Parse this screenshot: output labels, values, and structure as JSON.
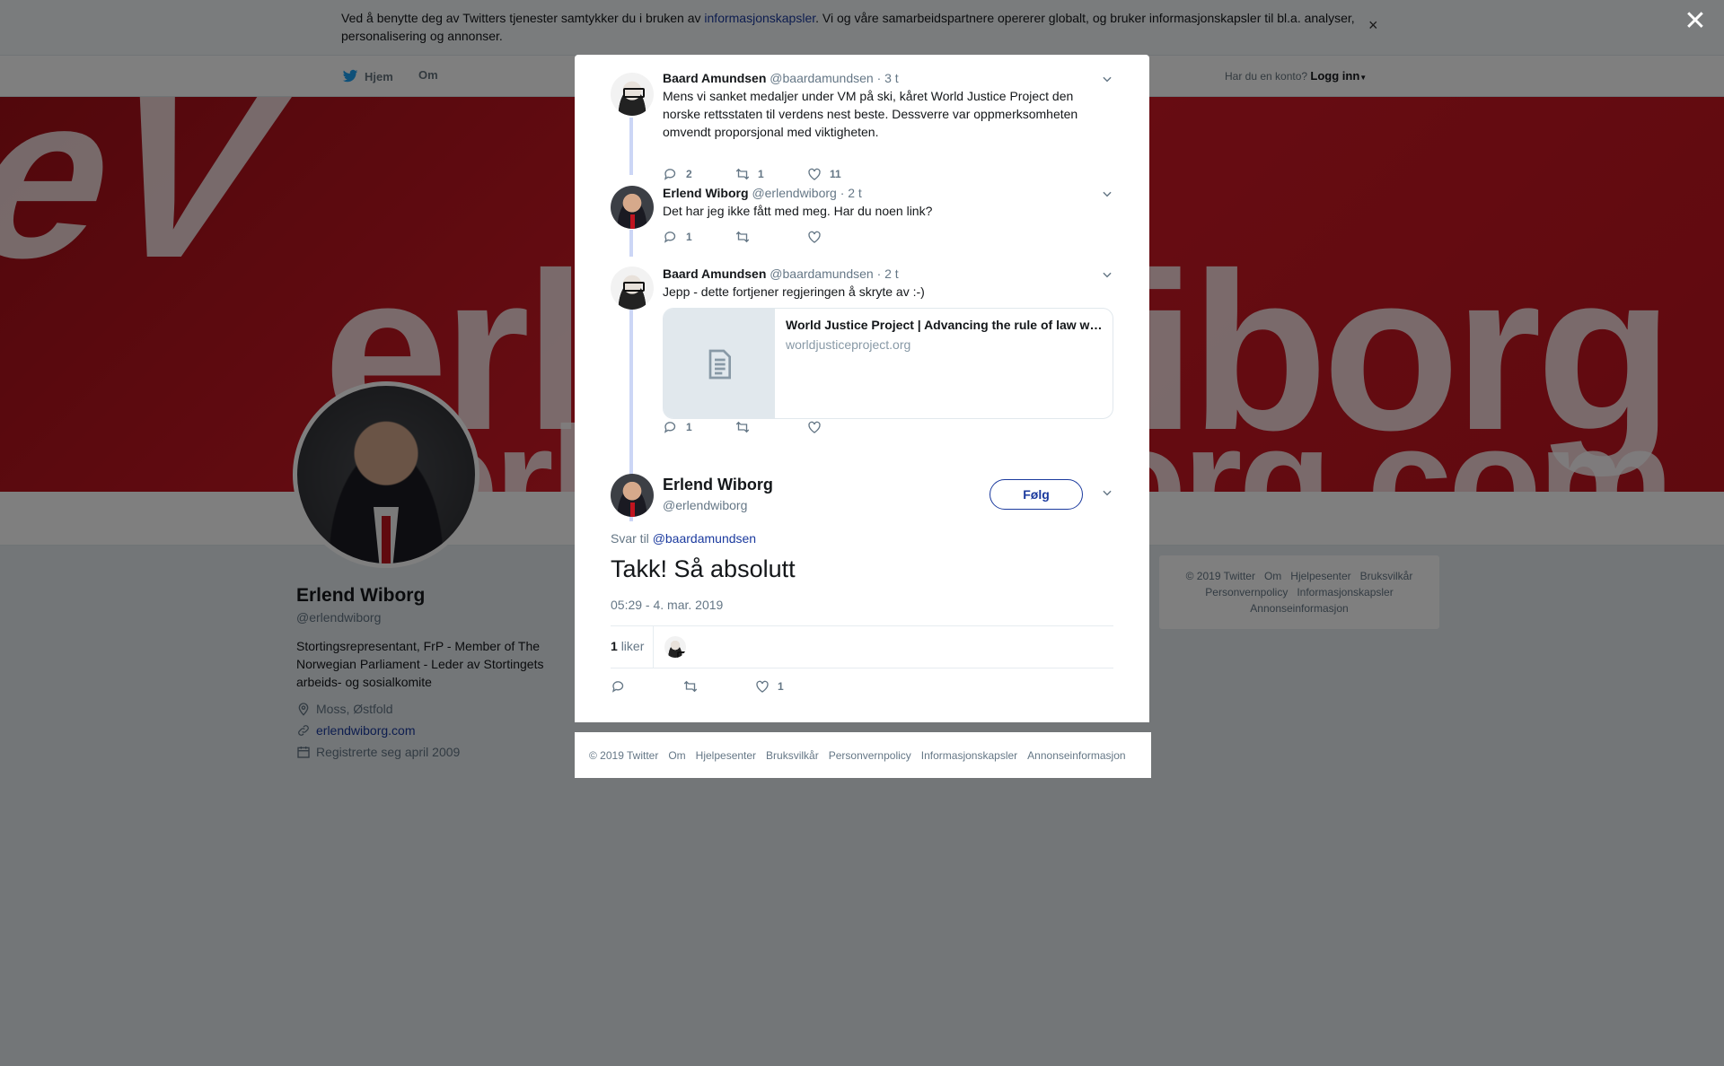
{
  "cookie": {
    "text_before": "Ved å benytte deg av Twitters tjenester samtykker du i bruken av ",
    "link": "informasjonskapsler",
    "text_after": ". Vi og våre samarbeidspartnere opererer globalt, og bruker informasjonskapsler til bl.a. analyser, personalisering og annonser.",
    "close": "×"
  },
  "nav": {
    "home": "Hjem",
    "about": "Om",
    "login_prompt": "Har du en konto?",
    "login": "Logg inn"
  },
  "banner": {
    "mark": "eV",
    "line1": "erlendwiborg",
    "line2": "erlendwiborg.com"
  },
  "profile": {
    "name": "Erlend Wiborg",
    "handle": "@erlendwiborg",
    "bio": "Stortingsrepresentant, FrP - Member of The Norwegian Parliament - Leder av Stortingets arbeids- og sosialkomite",
    "location": "Moss, Østfold",
    "website": "erlendwiborg.com",
    "joined": "Registrerte seg april 2009"
  },
  "right_footer": [
    "© 2019 Twitter",
    "Om",
    "Hjelpesenter",
    "Bruksvilkår",
    "Personvernpolicy",
    "Informasjonskapsler",
    "Annonseinformasjon"
  ],
  "overlay_close": "✕",
  "thread": [
    {
      "name": "Baard Amundsen",
      "handle": "@baardamundsen",
      "time": "· 3 t",
      "text": "Mens vi sanket medaljer under VM på ski, kåret World Justice Project den norske rettsstaten til verdens nest beste. Dessverre var oppmerksomheten omvendt proporsjonal med viktigheten.",
      "replies": "2",
      "retweets": "1",
      "likes": "11"
    },
    {
      "name": "Erlend Wiborg",
      "handle": "@erlendwiborg",
      "time": "· 2 t",
      "text": "Det har jeg ikke fått med meg. Har du noen link?",
      "replies": "1",
      "retweets": "",
      "likes": ""
    },
    {
      "name": "Baard Amundsen",
      "handle": "@baardamundsen",
      "time": "· 2 t",
      "text": "Jepp - dette fortjener regjeringen å skryte av :-)",
      "replies": "1",
      "retweets": "",
      "likes": "",
      "card_title": "World Justice Project | Advancing the rule of law worldwide",
      "card_domain": "worldjusticeproject.org"
    }
  ],
  "main_tweet": {
    "name": "Erlend Wiborg",
    "handle": "@erlendwiborg",
    "follow": "Følg",
    "reply_prefix": "Svar til",
    "reply_handle": "@baardamundsen",
    "text": "Takk! Så absolutt",
    "date": "05:29 - 4. mar. 2019",
    "likes_count": "1",
    "likes_label": "liker",
    "action_likes": "1"
  },
  "modal_footer": [
    "© 2019 Twitter",
    "Om",
    "Hjelpesenter",
    "Bruksvilkår",
    "Personvernpolicy",
    "Informasjonskapsler",
    "Annonseinformasjon"
  ],
  "colors": {
    "link": "#1b3a9e",
    "banner": "#c8151f",
    "thread_line": "#ccd6f6"
  }
}
